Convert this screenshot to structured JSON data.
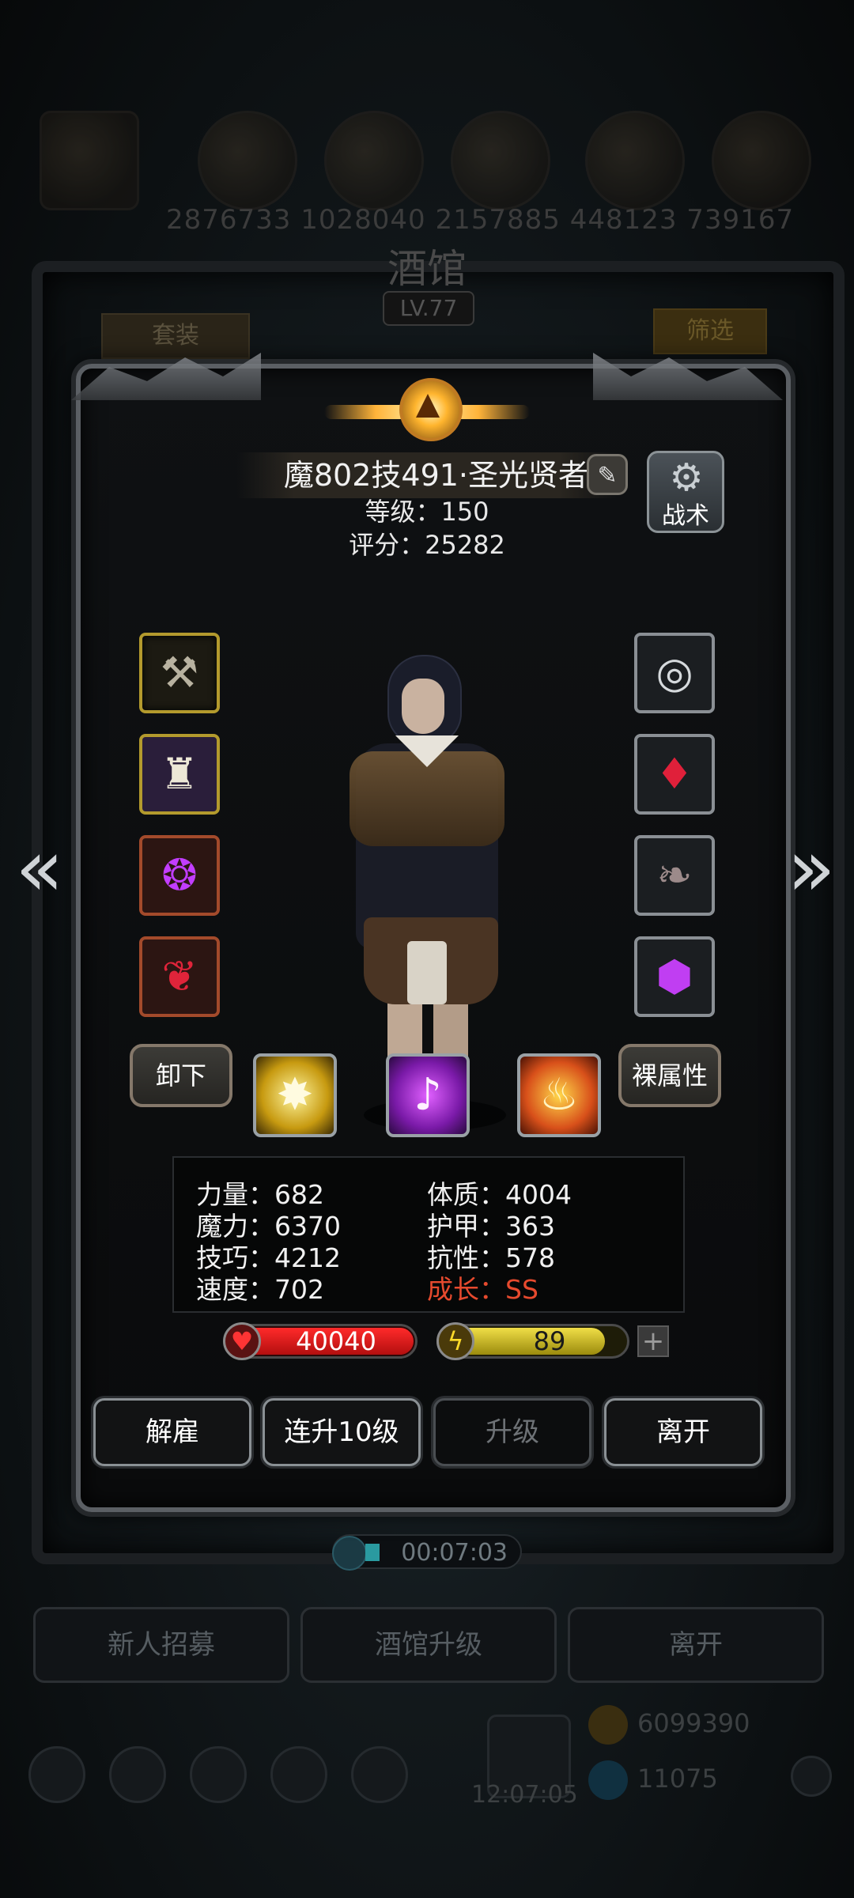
{
  "background": {
    "top_numbers": "2876733  1028040  2157885  448123  739167",
    "title": "酒馆",
    "level": "LV.77",
    "suit_button": "套装",
    "filter_button": "筛选",
    "timer": "00:07:03",
    "bottom_buttons": [
      "新人招募",
      "酒馆升级",
      "离开"
    ],
    "gold": "6099390",
    "gems": "11075",
    "clock": "12:07:05"
  },
  "hero": {
    "name": "魔802技491·圣光贤者",
    "level_label": "等级：150",
    "score_label": "评分：25282",
    "tactics_label": "战术",
    "unequip_label": "卸下",
    "base_attr_label": "裸属性"
  },
  "equipment": {
    "left": [
      "mace-icon",
      "robe-icon",
      "amulet-icon",
      "potion-icon"
    ],
    "right": [
      "halo-icon",
      "ruby-ring-icon",
      "feather-icon",
      "purple-gem-icon"
    ]
  },
  "skills": [
    "burst-icon",
    "music-note-icon",
    "fire-shield-icon"
  ],
  "stats": {
    "strength": "力量：682",
    "constitution": "体质：4004",
    "magic": "魔力：6370",
    "armor": "护甲：363",
    "skill": "技巧：4212",
    "resistance": "抗性：578",
    "speed": "速度：702",
    "growth": "成长：SS"
  },
  "hp": {
    "value": "40040",
    "fill": 1.0
  },
  "energy": {
    "value": "89",
    "fill": 0.89
  },
  "actions": {
    "dismiss": "解雇",
    "level_up_10": "连升10级",
    "level_up": "升级",
    "leave": "离开"
  },
  "colors": {
    "accent_gold": "#ffb43a",
    "growth_red": "#e64a2e"
  }
}
